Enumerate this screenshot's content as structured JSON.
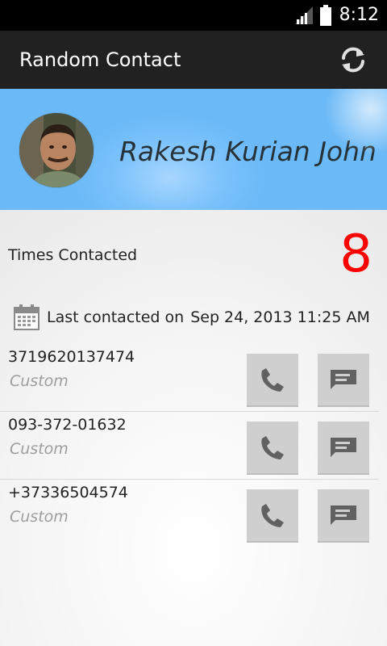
{
  "status_bar": {
    "time": "8:12"
  },
  "action_bar": {
    "title": "Random Contact",
    "refresh_icon": "refresh-icon"
  },
  "contact": {
    "name": "Rakesh Kurian John",
    "times_contacted_label": "Times Contacted",
    "times_contacted": "8",
    "last_contacted_label": "Last contacted on",
    "last_contacted_date": "Sep 24, 2013 11:25 AM"
  },
  "phones": [
    {
      "number": "3719620137474",
      "type": "Custom"
    },
    {
      "number": "093-372-01632",
      "type": "Custom"
    },
    {
      "number": "+37336504574",
      "type": "Custom"
    }
  ],
  "colors": {
    "count": "#ff0000",
    "banner": "#6bb9f7",
    "action_bar": "#212121",
    "button": "#cfcfcf"
  }
}
